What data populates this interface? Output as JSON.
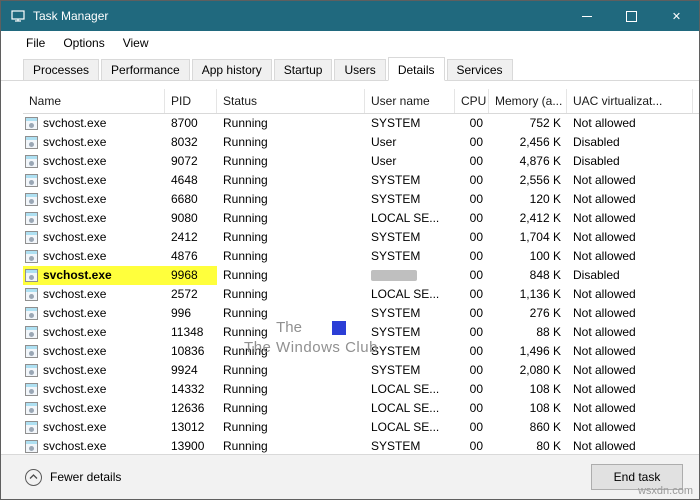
{
  "window": {
    "title": "Task Manager",
    "controls": {
      "minimize": "─",
      "maximize": "□",
      "close": "✕"
    }
  },
  "menu": [
    "File",
    "Options",
    "View"
  ],
  "tabs": [
    {
      "label": "Processes",
      "active": false
    },
    {
      "label": "Performance",
      "active": false
    },
    {
      "label": "App history",
      "active": false
    },
    {
      "label": "Startup",
      "active": false
    },
    {
      "label": "Users",
      "active": false
    },
    {
      "label": "Details",
      "active": true
    },
    {
      "label": "Services",
      "active": false
    }
  ],
  "table": {
    "columns": [
      "Name",
      "PID",
      "Status",
      "User name",
      "CPU",
      "Memory (a...",
      "UAC virtualizat..."
    ],
    "rows": [
      {
        "name": "svchost.exe",
        "pid": "8700",
        "status": "Running",
        "user": "SYSTEM",
        "cpu": "00",
        "memory": "752 K",
        "uac": "Not allowed"
      },
      {
        "name": "svchost.exe",
        "pid": "8032",
        "status": "Running",
        "user": "User",
        "cpu": "00",
        "memory": "2,456 K",
        "uac": "Disabled"
      },
      {
        "name": "svchost.exe",
        "pid": "9072",
        "status": "Running",
        "user": "User",
        "cpu": "00",
        "memory": "4,876 K",
        "uac": "Disabled"
      },
      {
        "name": "svchost.exe",
        "pid": "4648",
        "status": "Running",
        "user": "SYSTEM",
        "cpu": "00",
        "memory": "2,556 K",
        "uac": "Not allowed"
      },
      {
        "name": "svchost.exe",
        "pid": "6680",
        "status": "Running",
        "user": "SYSTEM",
        "cpu": "00",
        "memory": "120 K",
        "uac": "Not allowed"
      },
      {
        "name": "svchost.exe",
        "pid": "9080",
        "status": "Running",
        "user": "LOCAL SE...",
        "cpu": "00",
        "memory": "2,412 K",
        "uac": "Not allowed"
      },
      {
        "name": "svchost.exe",
        "pid": "2412",
        "status": "Running",
        "user": "SYSTEM",
        "cpu": "00",
        "memory": "1,704 K",
        "uac": "Not allowed"
      },
      {
        "name": "svchost.exe",
        "pid": "4876",
        "status": "Running",
        "user": "SYSTEM",
        "cpu": "00",
        "memory": "100 K",
        "uac": "Not allowed"
      },
      {
        "name": "svchost.exe",
        "pid": "9968",
        "status": "Running",
        "user": "",
        "cpu": "00",
        "memory": "848 K",
        "uac": "Disabled",
        "highlighted": true,
        "user_redacted": true
      },
      {
        "name": "svchost.exe",
        "pid": "2572",
        "status": "Running",
        "user": "LOCAL SE...",
        "cpu": "00",
        "memory": "1,136 K",
        "uac": "Not allowed"
      },
      {
        "name": "svchost.exe",
        "pid": "996",
        "status": "Running",
        "user": "SYSTEM",
        "cpu": "00",
        "memory": "276 K",
        "uac": "Not allowed"
      },
      {
        "name": "svchost.exe",
        "pid": "11348",
        "status": "Running",
        "user": "SYSTEM",
        "cpu": "00",
        "memory": "88 K",
        "uac": "Not allowed"
      },
      {
        "name": "svchost.exe",
        "pid": "10836",
        "status": "Running",
        "user": "SYSTEM",
        "cpu": "00",
        "memory": "1,496 K",
        "uac": "Not allowed"
      },
      {
        "name": "svchost.exe",
        "pid": "9924",
        "status": "Running",
        "user": "SYSTEM",
        "cpu": "00",
        "memory": "2,080 K",
        "uac": "Not allowed"
      },
      {
        "name": "svchost.exe",
        "pid": "14332",
        "status": "Running",
        "user": "LOCAL SE...",
        "cpu": "00",
        "memory": "108 K",
        "uac": "Not allowed"
      },
      {
        "name": "svchost.exe",
        "pid": "12636",
        "status": "Running",
        "user": "LOCAL SE...",
        "cpu": "00",
        "memory": "108 K",
        "uac": "Not allowed"
      },
      {
        "name": "svchost.exe",
        "pid": "13012",
        "status": "Running",
        "user": "LOCAL SE...",
        "cpu": "00",
        "memory": "860 K",
        "uac": "Not allowed"
      },
      {
        "name": "svchost.exe",
        "pid": "13900",
        "status": "Running",
        "user": "SYSTEM",
        "cpu": "00",
        "memory": "80 K",
        "uac": "Not allowed"
      }
    ]
  },
  "footer": {
    "fewer_details": "Fewer details",
    "end_task": "End task"
  },
  "watermark": {
    "line1": "The",
    "brand": "The Windows Club",
    "site": "wsxdn.com"
  },
  "colors": {
    "titlebar": "#20697e",
    "row_highlight": "#ffff3c",
    "watermark_logo_blue": "#2b3ed6"
  }
}
